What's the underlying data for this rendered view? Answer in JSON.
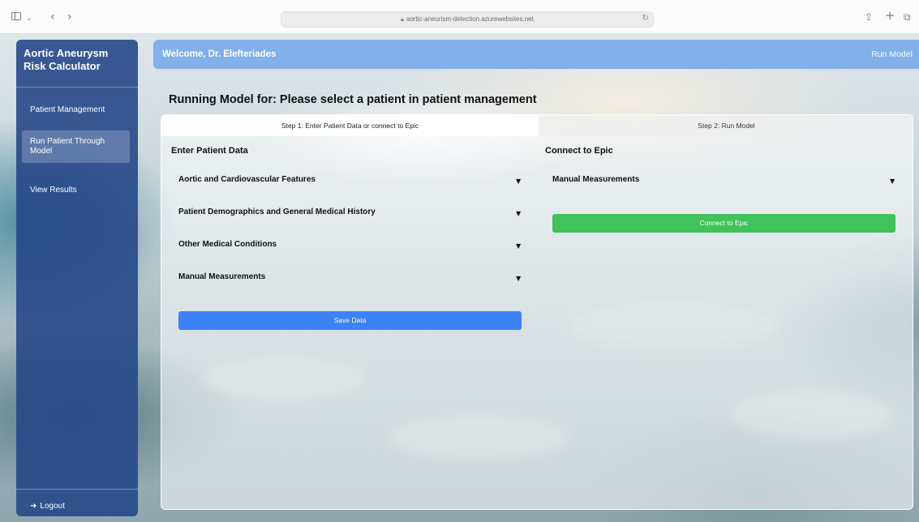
{
  "browser": {
    "url": "aortic-aneurism-detection.azurewebsites.net",
    "icons": {
      "sidebar": "sidebar-toggle-icon",
      "back": "chevron-left-icon",
      "forward": "chevron-right-icon",
      "lock": "lock-icon",
      "reload": "reload-icon",
      "share": "share-icon",
      "new_tab": "plus-icon",
      "tabs": "tab-overview-icon"
    }
  },
  "sidebar": {
    "brand": "Aortic Aneurysm Risk Calculator",
    "items": [
      {
        "label": "Patient Management",
        "active": false
      },
      {
        "label": "Run Patient Through Model",
        "active": true
      },
      {
        "label": "View Results",
        "active": false
      }
    ],
    "logout_label": "Logout"
  },
  "header": {
    "welcome": "Welcome, Dr. Elefteriades",
    "run_model": "Run Model"
  },
  "main": {
    "title": "Running Model for: Please select a patient in patient management",
    "tabs": [
      {
        "label": "Step 1: Enter Patient Data or connect to Epic",
        "active": true
      },
      {
        "label": "Step 2: Run Model",
        "active": false
      }
    ],
    "left": {
      "title": "Enter Patient Data",
      "sections": [
        "Aortic and Cardiovascular Features",
        "Patient Demographics and General Medical History",
        "Other Medical Conditions",
        "Manual Measurements"
      ],
      "save_button": "Save Data"
    },
    "right": {
      "title": "Connect to Epic",
      "sections": [
        "Manual Measurements"
      ],
      "connect_button": "Connect to Epic"
    }
  },
  "colors": {
    "sidebar_bg": "#26488a",
    "header_bg": "#78aaeb",
    "save_button": "#3b82f6",
    "connect_button": "#3fc35a"
  }
}
